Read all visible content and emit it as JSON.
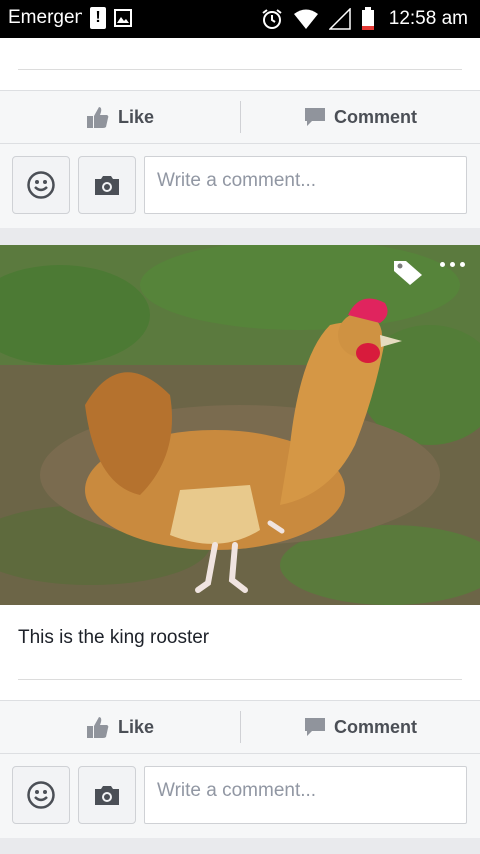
{
  "statusbar": {
    "app_title": "Emergency",
    "time": "12:58 am"
  },
  "posts": [
    {
      "actions": {
        "like": "Like",
        "comment": "Comment"
      },
      "composer": {
        "placeholder": "Write a comment..."
      }
    },
    {
      "caption": "This is the king rooster",
      "photo_subject": "rooster",
      "actions": {
        "like": "Like",
        "comment": "Comment"
      },
      "composer": {
        "placeholder": "Write a comment..."
      }
    }
  ],
  "icons": [
    "alert-icon",
    "image-icon",
    "alarm-icon",
    "wifi-icon",
    "signal-icon",
    "battery-icon",
    "like-icon",
    "comment-icon",
    "emoji-icon",
    "camera-icon",
    "tag-icon",
    "more-icon"
  ]
}
